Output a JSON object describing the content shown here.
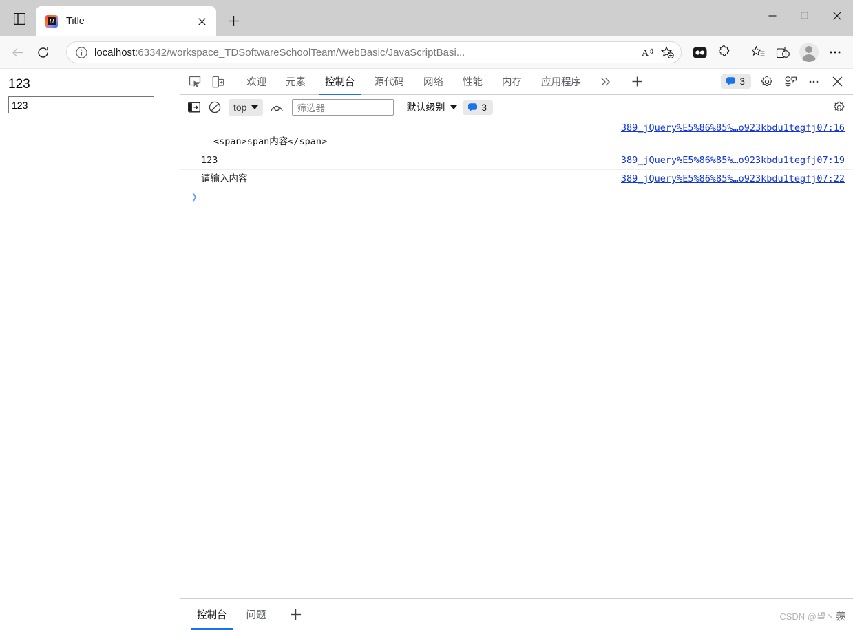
{
  "window": {
    "minimize_label": "Minimize",
    "maximize_label": "Maximize",
    "close_label": "Close"
  },
  "titlebar": {
    "tab_search_icon": "tab-search-icon",
    "tab": {
      "title": "Title",
      "favicon": "intellij-idea-favicon",
      "favicon_glyph": "IJ",
      "close_icon": "close-icon"
    },
    "new_tab_icon": "plus-icon"
  },
  "toolbar": {
    "back_icon": "back-arrow-icon",
    "refresh_icon": "refresh-icon",
    "omnibox": {
      "info_icon": "info-circle-icon",
      "url_host": "localhost",
      "url_path": ":63342/workspace_TDSoftwareSchoolTeam/WebBasic/JavaScriptBasi...",
      "read_aloud_icon": "read-aloud-icon",
      "favorite_icon": "add-favorite-star-icon"
    },
    "bing_icon": "bing-copilot-icon",
    "extensions_icon": "extensions-puzzle-icon",
    "favorites_icon": "favorites-star-list-icon",
    "collections_icon": "collections-icon",
    "profile_icon": "profile-avatar-icon",
    "settings_icon": "more-options-icon"
  },
  "page": {
    "heading_text": "123",
    "input_value": "123"
  },
  "devtools": {
    "inspect_icon": "inspect-element-icon",
    "device_toggle_icon": "device-toolbar-icon",
    "tabs": [
      {
        "label": "欢迎",
        "name": "tab-welcome",
        "active": false
      },
      {
        "label": "元素",
        "name": "tab-elements",
        "active": false
      },
      {
        "label": "控制台",
        "name": "tab-console",
        "active": true
      },
      {
        "label": "源代码",
        "name": "tab-sources",
        "active": false
      },
      {
        "label": "网络",
        "name": "tab-network",
        "active": false
      },
      {
        "label": "性能",
        "name": "tab-performance",
        "active": false
      },
      {
        "label": "内存",
        "name": "tab-memory",
        "active": false
      },
      {
        "label": "应用程序",
        "name": "tab-application",
        "active": false
      }
    ],
    "more_tabs_icon": "chevron-double-right-icon",
    "add_tab_icon": "plus-icon",
    "issues_badge": {
      "icon": "message-bubble-icon",
      "count": "3",
      "color": "#1a73e8"
    },
    "settings_icon": "gear-icon",
    "customize_icon": "customize-devtools-icon",
    "more_icon": "more-dots-icon",
    "close_icon": "close-devtools-icon"
  },
  "console_toolbar": {
    "sidebar_icon": "console-sidebar-icon",
    "clear_icon": "clear-console-icon",
    "context_selector": {
      "value": "top",
      "caret": "chevron-down-icon"
    },
    "live_expression_icon": "eye-live-expression-icon",
    "filter_placeholder": "筛选器",
    "level_selector": {
      "value": "默认级别",
      "caret": "chevron-down-icon"
    },
    "issues_count": "3",
    "settings_icon": "gear-icon"
  },
  "console_messages": [
    {
      "text": "<span>span内容</span>",
      "source": "389_jQuery%E5%86%85%…o923kbdu1tegfj07:16",
      "wrapped": true
    },
    {
      "text": "123",
      "source": "389_jQuery%E5%86%85%…o923kbdu1tegfj07:19",
      "wrapped": false
    },
    {
      "text": "请输入内容",
      "source": "389_jQuery%E5%86%85%…o923kbdu1tegfj07:22",
      "wrapped": false
    }
  ],
  "console_prompt": {
    "arrow": "❯",
    "input_value": ""
  },
  "drawer": {
    "tabs": [
      {
        "label": "控制台",
        "name": "drawer-tab-console",
        "active": true
      },
      {
        "label": "问题",
        "name": "drawer-tab-issues",
        "active": false
      }
    ],
    "add_icon": "plus-icon"
  },
  "watermark": {
    "text": "CSDN @望丶",
    "mark": "羨"
  }
}
